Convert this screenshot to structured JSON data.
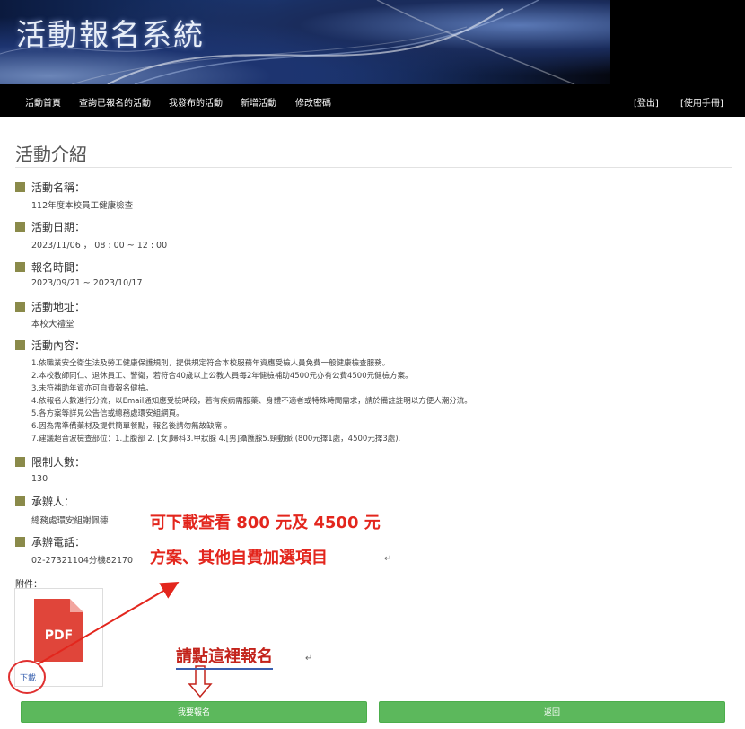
{
  "header": {
    "title": "活動報名系統"
  },
  "nav": {
    "items": [
      "活動首頁",
      "查詢已報名的活動",
      "我發布的活動",
      "新增活動",
      "修改密碼"
    ],
    "logout": "[登出]",
    "manual": "[使用手冊]"
  },
  "page": {
    "heading": "活動介紹"
  },
  "fields": {
    "name": {
      "label": "活動名稱：",
      "value": "112年度本校員工健康檢查"
    },
    "date": {
      "label": "活動日期：",
      "value": "2023/11/06 ， 08 : 00 ~ 12 : 00"
    },
    "signup": {
      "label": "報名時間：",
      "value": "2023/09/21 ~ 2023/10/17"
    },
    "location": {
      "label": "活動地址：",
      "value": "本校大禮堂"
    },
    "content": {
      "label": "活動內容：",
      "lines": [
        "1.依職業安全衛生法及勞工健康保護規則，提供規定符合本校服務年資應受檢人員免費一般健康檢查服務。",
        "2.本校教師同仁、退休員工、警衛，若符合40歲以上公教人員每2年健檢補助4500元亦有公費4500元健檢方案。",
        "3.未符補助年資亦可自費報名健檢。",
        "4.依報名人數進行分流，以Email通知應受檢時段，若有疾病需服藥、身體不適者或特殊時間需求，請於備註註明以方便人潮分流。",
        "5.各方案等詳見公告信或總務處環安組網頁。",
        "6.因為需準備藥材及提供簡單餐點，報名後請勿無故缺席 。",
        "7.建議超音波檢查部位：1.上腹部 2. [女]婦科3.甲狀腺 4.[男]攝護腺5.頸動脈 (800元擇1處，4500元擇3處)."
      ]
    },
    "limit": {
      "label": "限制人數：",
      "value": "130"
    },
    "organizer": {
      "label": "承辦人：",
      "value": "總務處環安組謝佩德"
    },
    "phone": {
      "label": "承辦電話：",
      "value": "02-27321104分機82170"
    }
  },
  "attachment": {
    "label": "附件：",
    "file_type": "PDF",
    "download": "下載"
  },
  "annotations": {
    "line1": "可下載查看 800 元及 4500 元",
    "line2": "方案、其他自費加選項目",
    "click_here": "請點這裡報名",
    "return_mark": "↵"
  },
  "buttons": {
    "register": "我要報名",
    "back": "返回"
  },
  "colors": {
    "button": "#5cb85c",
    "annotation": "#e3261d",
    "marker": "#8a8a4a"
  }
}
